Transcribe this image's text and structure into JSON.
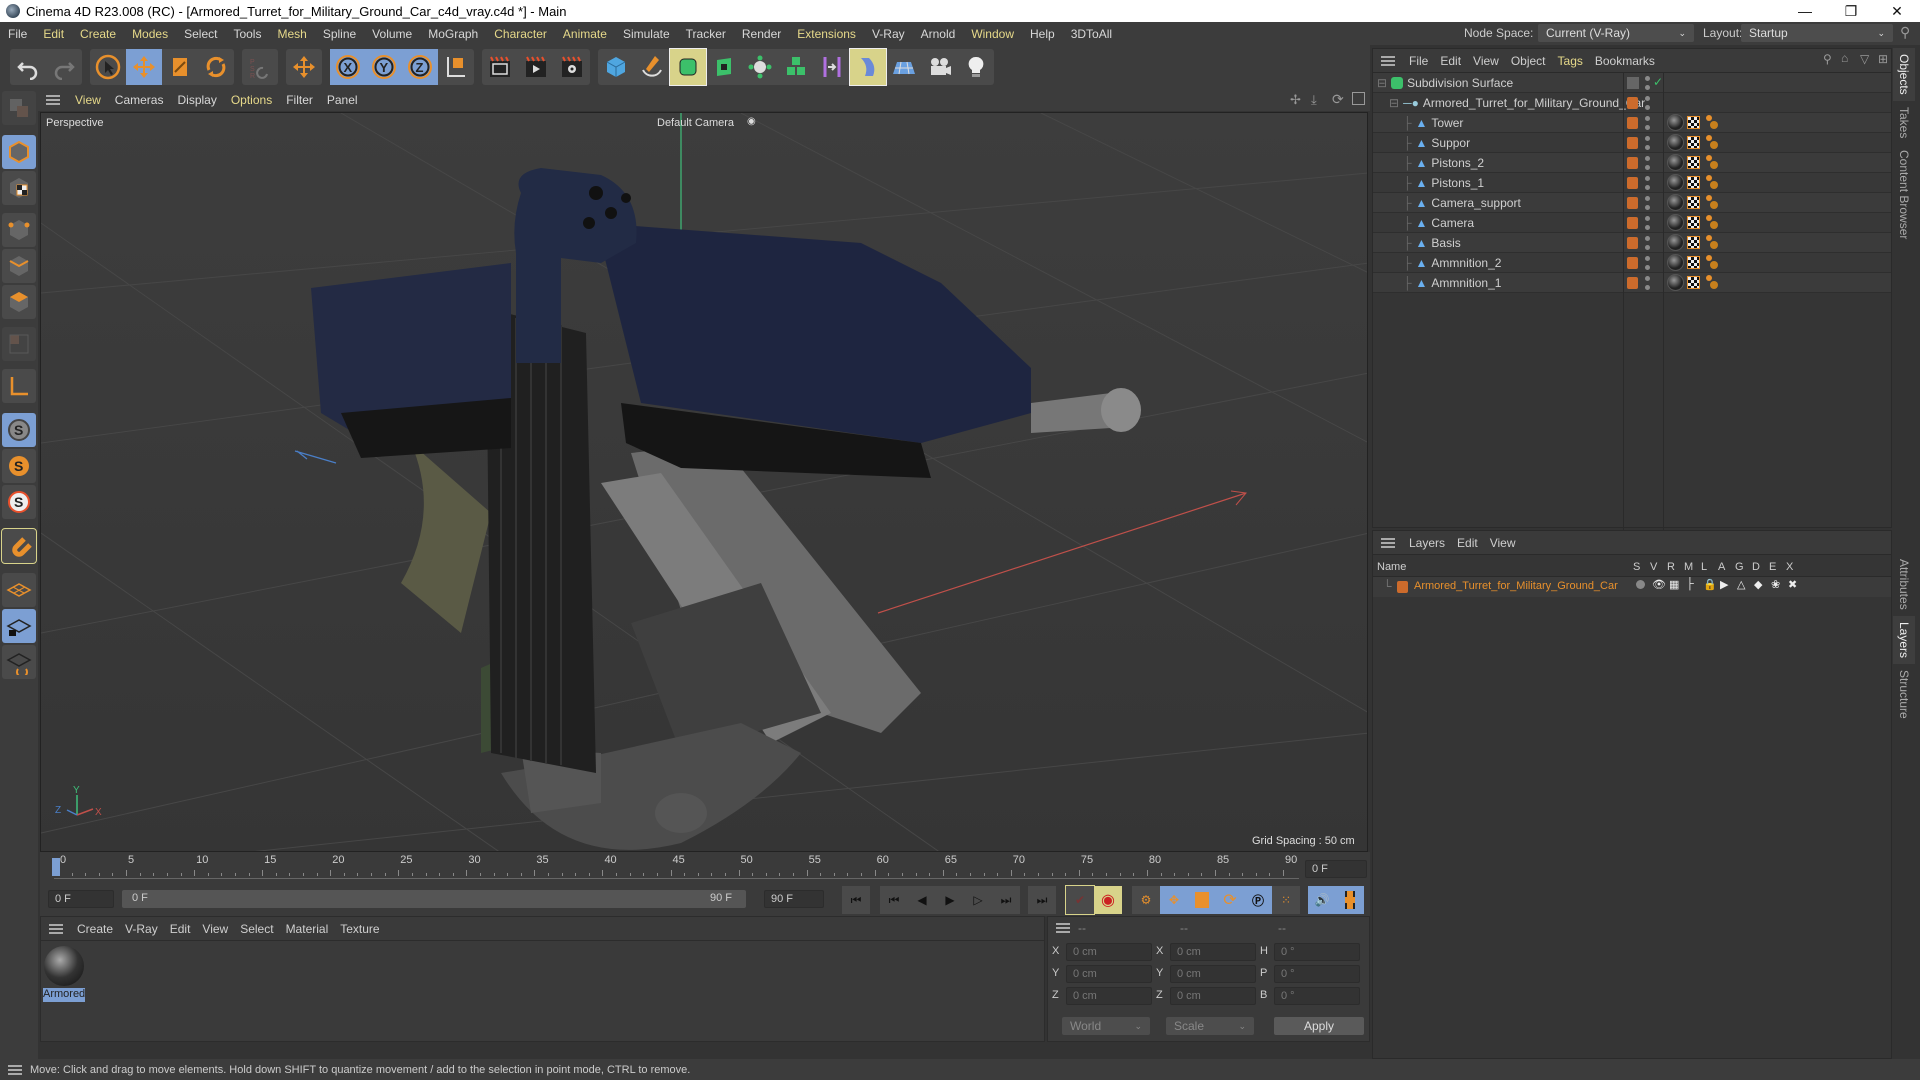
{
  "window": {
    "title": "Cinema 4D R23.008 (RC) - [Armored_Turret_for_Military_Ground_Car_c4d_vray.c4d *] - Main",
    "controls": {
      "minimize": "—",
      "maximize": "❐",
      "close": "✕"
    }
  },
  "menubar": {
    "items": [
      "File",
      "Edit",
      "Create",
      "Modes",
      "Select",
      "Tools",
      "Mesh",
      "Spline",
      "Volume",
      "MoGraph",
      "Character",
      "Animate",
      "Simulate",
      "Tracker",
      "Render",
      "Extensions",
      "V-Ray",
      "Arnold",
      "Window",
      "Help",
      "3DToAll"
    ],
    "node_space_label": "Node Space:",
    "node_space_value": "Current (V-Ray)",
    "layout_label": "Layout:",
    "layout_value": "Startup"
  },
  "toolbar": {
    "tools": [
      "undo",
      "redo",
      "select",
      "move",
      "scale",
      "rotate",
      "psr",
      "transform",
      "x-axis",
      "y-axis",
      "z-axis",
      "coordinate-system",
      "render-view",
      "render",
      "render-settings",
      "cube",
      "pen",
      "subdivision",
      "extrude",
      "mograph-cloner",
      "cube-array",
      "symmetry",
      "deformer",
      "floor",
      "camera",
      "light"
    ],
    "axis_labels": [
      "X",
      "Y",
      "Z"
    ]
  },
  "viewport": {
    "menu": [
      "View",
      "Cameras",
      "Display",
      "Options",
      "Filter",
      "Panel"
    ],
    "view_name": "Perspective",
    "camera_name": "Default Camera",
    "grid_spacing": "Grid Spacing : 50 cm",
    "axis_labels": {
      "x": "X",
      "y": "Y",
      "z": "Z"
    }
  },
  "timeline": {
    "ticks": [
      "0",
      "5",
      "10",
      "15",
      "20",
      "25",
      "30",
      "35",
      "40",
      "45",
      "50",
      "55",
      "60",
      "65",
      "70",
      "75",
      "80",
      "85",
      "90"
    ],
    "current_frame": "0 F",
    "start_frame": "0 F",
    "range_start": "0 F",
    "range_end": "90 F",
    "end_frame": "90 F",
    "frame_display": "0 F"
  },
  "material_manager": {
    "menu": [
      "Create",
      "V-Ray",
      "Edit",
      "View",
      "Select",
      "Material",
      "Texture"
    ],
    "materials": [
      {
        "name": "Armored"
      }
    ]
  },
  "coordinates": {
    "headers": [
      "--",
      "--",
      "--"
    ],
    "position": [
      {
        "axis": "X",
        "value": "0 cm"
      },
      {
        "axis": "Y",
        "value": "0 cm"
      },
      {
        "axis": "Z",
        "value": "0 cm"
      }
    ],
    "size": [
      {
        "axis": "X",
        "value": "0 cm"
      },
      {
        "axis": "Y",
        "value": "0 cm"
      },
      {
        "axis": "Z",
        "value": "0 cm"
      }
    ],
    "rotation": [
      {
        "axis": "H",
        "value": "0 °"
      },
      {
        "axis": "P",
        "value": "0 °"
      },
      {
        "axis": "B",
        "value": "0 °"
      }
    ],
    "mode_select": "World",
    "size_select": "Scale",
    "apply_label": "Apply"
  },
  "object_manager": {
    "menu": [
      "File",
      "Edit",
      "View",
      "Object",
      "Tags",
      "Bookmarks"
    ],
    "root": "Subdivision Surface",
    "group": "Armored_Turret_for_Military_Ground_Car",
    "children": [
      "Tower",
      "Suppor",
      "Pistons_2",
      "Pistons_1",
      "Camera_support",
      "Camera",
      "Basis",
      "Ammnition_2",
      "Ammnition_1"
    ]
  },
  "layer_manager": {
    "menu": [
      "Layers",
      "Edit",
      "View"
    ],
    "columns": [
      "Name",
      "S",
      "V",
      "R",
      "M",
      "L",
      "A",
      "G",
      "D",
      "E",
      "X"
    ],
    "layers": [
      {
        "name": "Armored_Turret_for_Military_Ground_Car",
        "color": "#cc6b2c"
      }
    ]
  },
  "side_tabs": {
    "top": [
      "Objects",
      "Takes",
      "Content Browser"
    ],
    "bottom": [
      "Attributes",
      "Layers",
      "Structure"
    ]
  },
  "status": {
    "message": "Move: Click and drag to move elements. Hold down SHIFT to quantize movement / add to the selection in point mode, CTRL to remove."
  },
  "colors": {
    "accent_blue": "#7c9fd3",
    "highlight_yellow": "#d8d38a",
    "layer_orange": "#cc6b2c",
    "menu_yellow": "#e6d98a"
  }
}
